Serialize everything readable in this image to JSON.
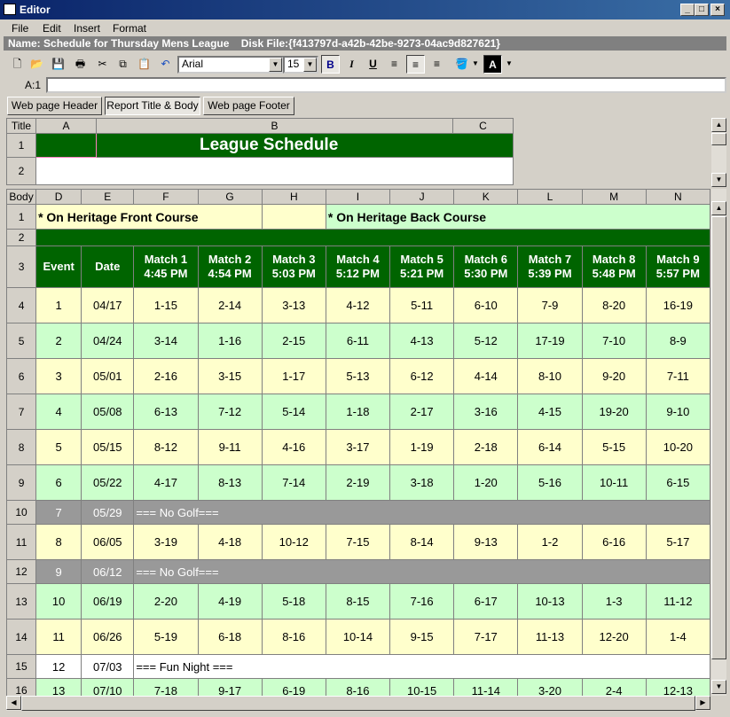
{
  "window": {
    "title": "Editor",
    "min": "_",
    "max": "□",
    "close": "×"
  },
  "menu": [
    "File",
    "Edit",
    "Insert",
    "Format"
  ],
  "namebar": {
    "name_label": "Name:",
    "name": "Schedule for Thursday Mens League",
    "disk_label": "Disk File:",
    "disk": "{f413797d-a42b-42be-9273-04ac9d827621}"
  },
  "toolbar": {
    "font": "Arial",
    "size": "15",
    "bold": "B",
    "italic": "I",
    "underline": "U",
    "font_color": "A"
  },
  "formula": {
    "ref": "A:1",
    "value": ""
  },
  "tabs": [
    "Web page Header",
    "Report Title & Body",
    "Web page Footer"
  ],
  "title_grid": {
    "corner": "Title",
    "cols": [
      "A",
      "B",
      "C"
    ],
    "rows": [
      "1",
      "2"
    ],
    "title": "League Schedule"
  },
  "body_grid": {
    "corner": "Body",
    "cols": [
      "D",
      "E",
      "F",
      "G",
      "H",
      "I",
      "J",
      "K",
      "L",
      "M",
      "N"
    ],
    "row1": {
      "front": "* On Heritage Front Course",
      "back": "* On Heritage Back Course"
    },
    "header": [
      "Event",
      "Date",
      "Match 1",
      "Match 2",
      "Match 3",
      "Match 4",
      "Match 5",
      "Match 6",
      "Match 7",
      "Match 8",
      "Match 9"
    ],
    "header_times": [
      "",
      "",
      "4:45 PM",
      "4:54 PM",
      "5:03 PM",
      "5:12 PM",
      "5:21 PM",
      "5:30 PM",
      "5:39 PM",
      "5:48 PM",
      "5:57 PM"
    ],
    "rows": [
      {
        "n": "4",
        "style": "y",
        "cells": [
          "1",
          "04/17",
          "1-15",
          "2-14",
          "3-13",
          "4-12",
          "5-11",
          "6-10",
          "7-9",
          "8-20",
          "16-19"
        ]
      },
      {
        "n": "5",
        "style": "lg",
        "cells": [
          "2",
          "04/24",
          "3-14",
          "1-16",
          "2-15",
          "6-11",
          "4-13",
          "5-12",
          "17-19",
          "7-10",
          "8-9"
        ]
      },
      {
        "n": "6",
        "style": "y",
        "cells": [
          "3",
          "05/01",
          "2-16",
          "3-15",
          "1-17",
          "5-13",
          "6-12",
          "4-14",
          "8-10",
          "9-20",
          "7-11"
        ]
      },
      {
        "n": "7",
        "style": "lg",
        "cells": [
          "4",
          "05/08",
          "6-13",
          "7-12",
          "5-14",
          "1-18",
          "2-17",
          "3-16",
          "4-15",
          "19-20",
          "9-10"
        ]
      },
      {
        "n": "8",
        "style": "y",
        "cells": [
          "5",
          "05/15",
          "8-12",
          "9-11",
          "4-16",
          "3-17",
          "1-19",
          "2-18",
          "6-14",
          "5-15",
          "10-20"
        ]
      },
      {
        "n": "9",
        "style": "lg",
        "cells": [
          "6",
          "05/22",
          "4-17",
          "8-13",
          "7-14",
          "2-19",
          "3-18",
          "1-20",
          "5-16",
          "10-11",
          "6-15"
        ]
      },
      {
        "n": "10",
        "style": "gr",
        "note": "=== No Golf===",
        "cells": [
          "7",
          "05/29"
        ]
      },
      {
        "n": "11",
        "style": "y",
        "cells": [
          "8",
          "06/05",
          "3-19",
          "4-18",
          "10-12",
          "7-15",
          "8-14",
          "9-13",
          "1-2",
          "6-16",
          "5-17"
        ]
      },
      {
        "n": "12",
        "style": "gr",
        "note": "=== No Golf===",
        "cells": [
          "9",
          "06/12"
        ]
      },
      {
        "n": "13",
        "style": "lg",
        "cells": [
          "10",
          "06/19",
          "2-20",
          "4-19",
          "5-18",
          "8-15",
          "7-16",
          "6-17",
          "10-13",
          "1-3",
          "11-12"
        ]
      },
      {
        "n": "14",
        "style": "y",
        "cells": [
          "11",
          "06/26",
          "5-19",
          "6-18",
          "8-16",
          "10-14",
          "9-15",
          "7-17",
          "11-13",
          "12-20",
          "1-4"
        ]
      },
      {
        "n": "15",
        "style": "w",
        "note": "=== Fun Night ===",
        "cells": [
          "12",
          "07/03"
        ]
      },
      {
        "n": "16",
        "style": "lg",
        "cells": [
          "13",
          "07/10",
          "7-18",
          "9-17",
          "6-19",
          "8-16",
          "10-15",
          "11-14",
          "3-20",
          "2-4",
          "12-13"
        ]
      }
    ]
  }
}
